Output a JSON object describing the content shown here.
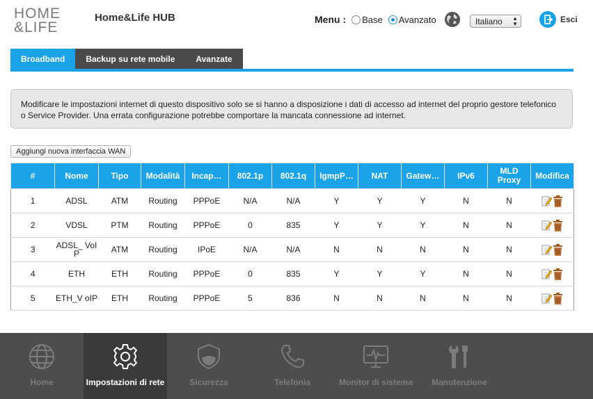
{
  "header": {
    "logo_line1": "HOME",
    "logo_line2": "&LIFE",
    "title": "Home&Life HUB",
    "menu_label": "Menu :",
    "menu_options": [
      "Base",
      "Avanzato"
    ],
    "menu_selected": "Avanzato",
    "language": "Italiano",
    "exit_label": "Esci"
  },
  "tabs": [
    {
      "label": "Broadband",
      "active": true
    },
    {
      "label": "Backup su rete mobile",
      "active": false
    },
    {
      "label": "Avanzate",
      "active": false
    }
  ],
  "notice": "Modificare le impostazioni internet di questo dispositivo solo se si hanno a disposizione i dati di accesso ad internet del proprio gestore telefonico o Service Provider. Una errata configurazione potrebbe comportare la mancata connessione ad internet.",
  "add_button": "Aggiungi nuova interfaccia WAN",
  "table": {
    "headers": [
      "#",
      "Nome",
      "Tipo",
      "Modalità",
      "Incap…",
      "802.1p",
      "802.1q",
      "IgmpP…",
      "NAT",
      "Gatew…",
      "IPv6",
      "MLD Proxy",
      "Modifica"
    ],
    "rows": [
      [
        "1",
        "ADSL",
        "ATM",
        "Routing",
        "PPPoE",
        "N/A",
        "N/A",
        "Y",
        "Y",
        "Y",
        "N",
        "N"
      ],
      [
        "2",
        "VDSL",
        "PTM",
        "Routing",
        "PPPoE",
        "0",
        "835",
        "Y",
        "Y",
        "Y",
        "N",
        "N"
      ],
      [
        "3",
        "ADSL_ VoIP",
        "ATM",
        "Routing",
        "IPoE",
        "N/A",
        "N/A",
        "N",
        "N",
        "N",
        "N",
        "N"
      ],
      [
        "4",
        "ETH",
        "ETH",
        "Routing",
        "PPPoE",
        "0",
        "835",
        "Y",
        "Y",
        "Y",
        "N",
        "N"
      ],
      [
        "5",
        "ETH_V oIP",
        "ETH",
        "Routing",
        "PPPoE",
        "5",
        "836",
        "N",
        "N",
        "N",
        "N",
        "N"
      ]
    ]
  },
  "bottom_nav": [
    {
      "label": "Home",
      "icon": "globe-icon",
      "active": false
    },
    {
      "label": "Impostazioni di rete",
      "icon": "gear-icon",
      "active": true
    },
    {
      "label": "Sicurezza",
      "icon": "shield-icon",
      "active": false
    },
    {
      "label": "Telefonia",
      "icon": "phone-icon",
      "active": false
    },
    {
      "label": "Monitor di sistema",
      "icon": "monitor-icon",
      "active": false
    },
    {
      "label": "Manutenzione",
      "icon": "tools-icon",
      "active": false
    }
  ],
  "colors": {
    "accent": "#1aa3e8",
    "tab_inactive": "#4a4a4a",
    "bottom_bar": "#4d4d4d",
    "bottom_active": "#3a3a3a"
  }
}
